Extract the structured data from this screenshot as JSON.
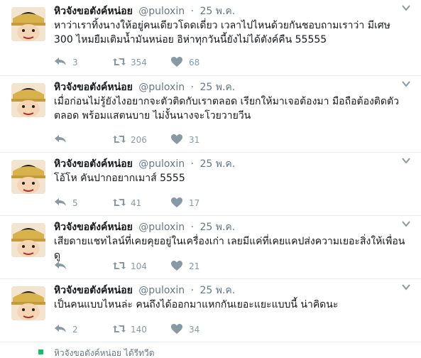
{
  "tweets": [
    {
      "name": "หิวจังขอตังค์หน่อย",
      "handle": "@puloxin",
      "dot": "·",
      "time": "25 พ.ค.",
      "text": "หาว่าเราทิ้งนางให้อยู่คนเดียวโดดเดี่ยว เวลาไปไหนด้วยกันชอบถามเราว่า มีเศษ 300 ไหมยืมเติมน้ำมันหน่อย อิห่าทุกวันนี้ยังไม่ได้ตังค์คืน 55555",
      "replies": "3",
      "retweets": "354",
      "likes": "68"
    },
    {
      "name": "หิวจังขอตังค์หน่อย",
      "handle": "@puloxin",
      "dot": "·",
      "time": "25 พ.ค.",
      "text": "เมื่อก่อนไม่รู้ยังไงอยากจะตัวติดกับเราตลอด เรียกให้มาเจอต้องมา มือถือต้องติดตัวตลอด พร้อมแสตนบาย ไม่งั้นนางจะโวยวายวีน",
      "replies": "",
      "retweets": "206",
      "likes": "31"
    },
    {
      "name": "หิวจังขอตังค์หน่อย",
      "handle": "@puloxin",
      "dot": "·",
      "time": "25 พ.ค.",
      "text": "โอ้โห คันปากอยากเมาส์ 5555",
      "replies": "5",
      "retweets": "41",
      "likes": "17"
    },
    {
      "name": "หิวจังขอตังค์หน่อย",
      "handle": "@puloxin",
      "dot": "·",
      "time": "25 พ.ค.",
      "text": "เสียดายแชทไลน์ที่เคยคุยอยู่ในเครื่องเก่า เลยมีแค่ที่เคยแคปส่งความเยอะสิ่งให้เพื่อนดู",
      "replies": "",
      "retweets": "104",
      "likes": "21"
    },
    {
      "name": "หิวจังขอตังค์หน่อย",
      "handle": "@puloxin",
      "dot": "·",
      "time": "25 พ.ค.",
      "text": "เป็นคนแบบไหนล่ะ คนถึงได้ออกมาแหกกันเยอะแยะแบบนี้ น่าคิดนะ",
      "replies": "2",
      "retweets": "140",
      "likes": "34"
    }
  ],
  "bottom_cutoff": "หิวจังขอตังค์หน่อย ได้รีทวีต",
  "icons": {
    "reply": "reply-icon",
    "retweet": "retweet-icon",
    "like": "heart-icon",
    "caret": "chevron-down-icon"
  },
  "colors": {
    "action_gray": "#8899a6",
    "handle_gray": "#657786",
    "divider": "#e6ecf0",
    "retweet_green": "#17bf63"
  }
}
